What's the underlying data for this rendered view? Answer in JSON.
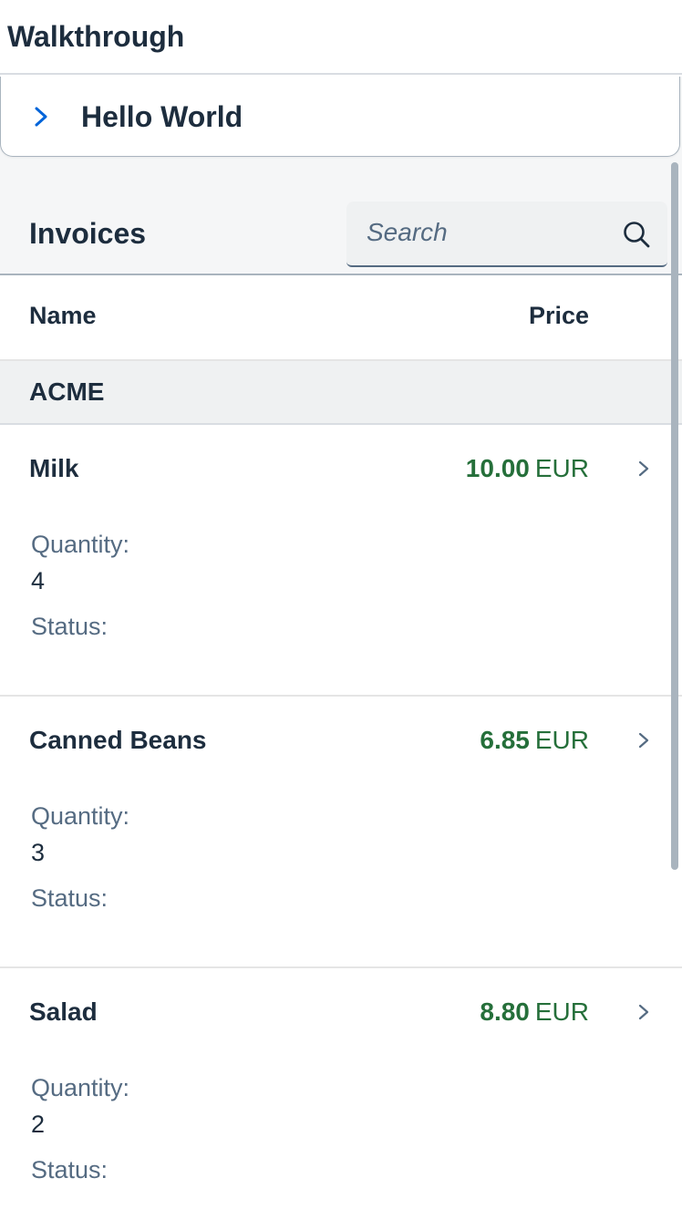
{
  "app": {
    "title": "Walkthrough"
  },
  "panel": {
    "title": "Hello World",
    "expanded": false
  },
  "invoices": {
    "title": "Invoices",
    "search": {
      "placeholder": "Search",
      "value": ""
    },
    "columns": {
      "name": "Name",
      "price": "Price"
    },
    "groups": [
      {
        "label": "ACME",
        "rows": [
          {
            "name": "Milk",
            "price": "10.00",
            "currency": "EUR",
            "quantity_label": "Quantity:",
            "quantity": "4",
            "status_label": "Status:"
          },
          {
            "name": "Canned Beans",
            "price": "6.85",
            "currency": "EUR",
            "quantity_label": "Quantity:",
            "quantity": "3",
            "status_label": "Status:"
          },
          {
            "name": "Salad",
            "price": "8.80",
            "currency": "EUR",
            "quantity_label": "Quantity:",
            "quantity": "2",
            "status_label": "Status:"
          }
        ]
      }
    ]
  },
  "colors": {
    "price_positive": "#256f3a",
    "text_primary": "#1d2d3e",
    "text_secondary": "#556b82",
    "accent": "#0064d9"
  },
  "icons": {
    "panel_toggle": "chevron-right-icon",
    "search": "search-icon",
    "row_navigation": "chevron-right-icon"
  }
}
